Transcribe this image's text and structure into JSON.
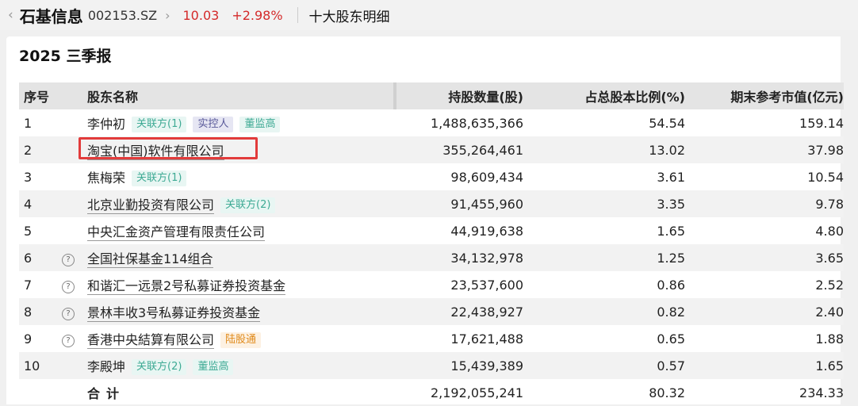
{
  "header": {
    "back_icon": "‹",
    "stock_name": "石基信息",
    "code": "002153.SZ",
    "chevron": "›",
    "price": "10.03",
    "change": "+2.98%",
    "page_title": "十大股东明细"
  },
  "report": {
    "title": "2025 三季报"
  },
  "table": {
    "headers": {
      "idx": "序号",
      "name": "股东名称",
      "shares": "持股数量(股)",
      "pct": "占总股本比例(%)",
      "mv": "期末参考市值(亿元)"
    },
    "rows": [
      {
        "idx": "1",
        "name": "李仲初",
        "shares": "1,488,635,366",
        "pct": "54.54",
        "mv": "159.14",
        "tag1": "关联方(1)",
        "tag2": "实控人",
        "tag3": "董监高"
      },
      {
        "idx": "2",
        "name": "淘宝(中国)软件有限公司",
        "shares": "355,264,461",
        "pct": "13.02",
        "mv": "37.98"
      },
      {
        "idx": "3",
        "name": "焦梅荣",
        "shares": "98,609,434",
        "pct": "3.61",
        "mv": "10.54",
        "tag1": "关联方(1)"
      },
      {
        "idx": "4",
        "name": "北京业勤投资有限公司",
        "shares": "91,455,960",
        "pct": "3.35",
        "mv": "9.78",
        "tag1": "关联方(2)"
      },
      {
        "idx": "5",
        "name": "中央汇金资产管理有限责任公司",
        "shares": "44,919,638",
        "pct": "1.65",
        "mv": "4.80"
      },
      {
        "idx": "6",
        "name": "全国社保基金114组合",
        "shares": "34,132,978",
        "pct": "1.25",
        "mv": "3.65",
        "q": "?"
      },
      {
        "idx": "7",
        "name": "和谐汇一远景2号私募证券投资基金",
        "shares": "23,537,600",
        "pct": "0.86",
        "mv": "2.52",
        "q": "?"
      },
      {
        "idx": "8",
        "name": "景林丰收3号私募证券投资基金",
        "shares": "22,438,927",
        "pct": "0.82",
        "mv": "2.40",
        "q": "?"
      },
      {
        "idx": "9",
        "name": "香港中央結算有限公司",
        "shares": "17,621,488",
        "pct": "0.65",
        "mv": "1.88",
        "q": "?",
        "tag1": "陆股通"
      },
      {
        "idx": "10",
        "name": "李殿坤",
        "shares": "15,439,389",
        "pct": "0.57",
        "mv": "1.65",
        "tag1": "关联方(2)",
        "tag2": "董监高"
      }
    ],
    "total": {
      "label": "合计",
      "shares": "2,192,055,241",
      "pct": "80.32",
      "mv": "234.33"
    }
  },
  "colors": {
    "up": "#d42a2a",
    "highlight": "#e23b3b",
    "tag_green": "#3eaa94",
    "tag_orange": "#e08a1a"
  }
}
